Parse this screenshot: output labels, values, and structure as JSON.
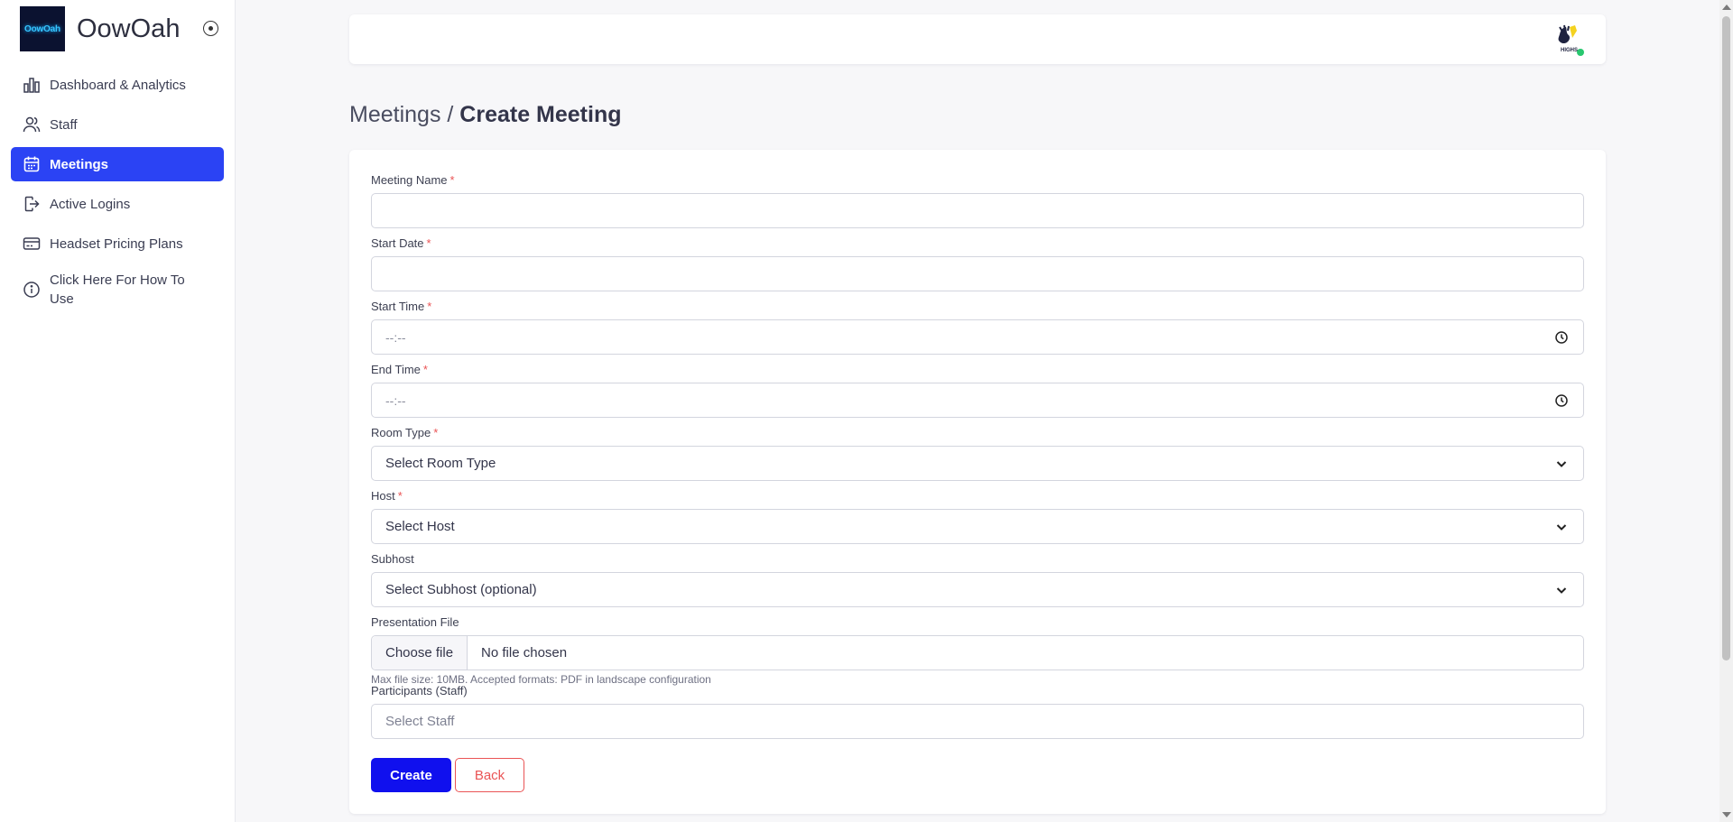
{
  "brand": {
    "logo_text": "OowOah",
    "name": "OowOah"
  },
  "sidebar": {
    "items": [
      {
        "label": "Dashboard & Analytics",
        "icon": "bar-chart-icon",
        "active": false
      },
      {
        "label": "Staff",
        "icon": "users-icon",
        "active": false
      },
      {
        "label": "Meetings",
        "icon": "calendar-icon",
        "active": true
      },
      {
        "label": "Active Logins",
        "icon": "login-icon",
        "active": false
      },
      {
        "label": "Headset Pricing Plans",
        "icon": "credit-card-icon",
        "active": false
      },
      {
        "label": "Click Here For How To Use",
        "icon": "info-icon",
        "active": false
      }
    ]
  },
  "breadcrumb": {
    "parent": "Meetings / ",
    "current": "Create Meeting"
  },
  "topbar": {
    "avatar_text": "HIGHS"
  },
  "form": {
    "meeting_name": {
      "label": "Meeting Name",
      "required": "*",
      "value": ""
    },
    "start_date": {
      "label": "Start Date",
      "required": "*",
      "value": ""
    },
    "start_time": {
      "label": "Start Time",
      "required": "*",
      "value": "--:--"
    },
    "end_time": {
      "label": "End Time",
      "required": "*",
      "value": "--:--"
    },
    "room_type": {
      "label": "Room Type",
      "required": "*",
      "value": "Select Room Type"
    },
    "host": {
      "label": "Host",
      "required": "*",
      "value": "Select Host"
    },
    "subhost": {
      "label": "Subhost",
      "value": "Select Subhost (optional)"
    },
    "presentation_file": {
      "label": "Presentation File",
      "button": "Choose file",
      "status": "No file chosen",
      "help": "Max file size: 10MB. Accepted formats: PDF in landscape configuration"
    },
    "participants": {
      "label": "Participants (Staff)",
      "placeholder": "Select Staff"
    }
  },
  "actions": {
    "create": "Create",
    "back": "Back"
  },
  "colors": {
    "primary": "#1010ee",
    "nav_active": "#2b43f4",
    "danger": "#ea5455",
    "online": "#28c76f"
  }
}
